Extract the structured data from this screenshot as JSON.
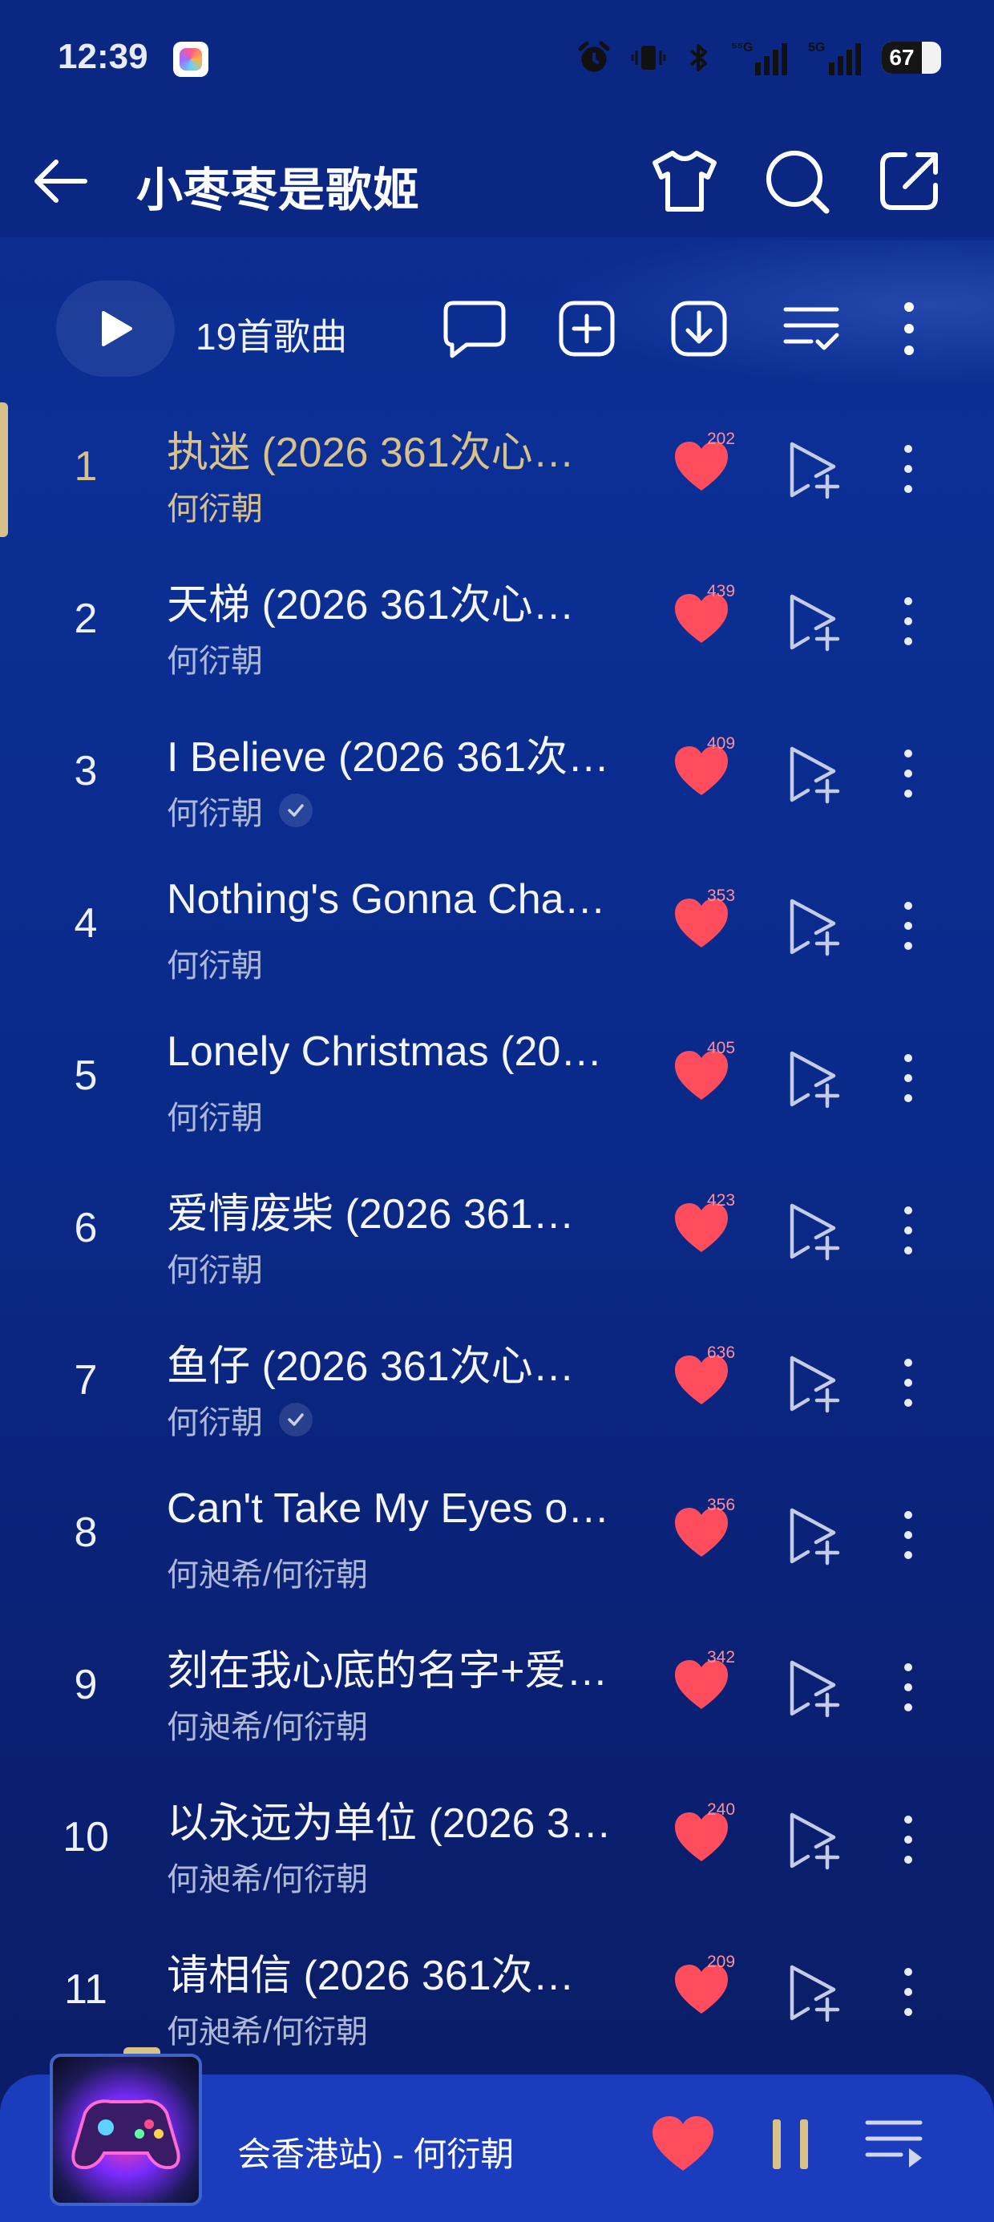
{
  "status_bar": {
    "time": "12:39",
    "network_1": "5G",
    "network_2": "5G",
    "battery": "67"
  },
  "header": {
    "title": "小枣枣是歌姬"
  },
  "toolbar": {
    "song_count": "19首歌曲"
  },
  "songs": [
    {
      "num": "1",
      "title": "执迷 (2026 361次心动…",
      "artist": "何衍朝",
      "likes": "202",
      "verified": false,
      "active": true
    },
    {
      "num": "2",
      "title": "天梯 (2026 361次心动…",
      "artist": "何衍朝",
      "likes": "439",
      "verified": false
    },
    {
      "num": "3",
      "title": "I Believe (2026 361次…",
      "artist": "何衍朝",
      "likes": "409",
      "verified": true
    },
    {
      "num": "4",
      "title": "Nothing's Gonna Chan…",
      "artist": "何衍朝",
      "likes": "353",
      "verified": false
    },
    {
      "num": "5",
      "title": "Lonely Christmas (20…",
      "artist": "何衍朝",
      "likes": "405",
      "verified": false
    },
    {
      "num": "6",
      "title": "爱情废柴 (2026 361次…",
      "artist": "何衍朝",
      "likes": "423",
      "verified": false
    },
    {
      "num": "7",
      "title": "鱼仔 (2026 361次心动…",
      "artist": "何衍朝",
      "likes": "636",
      "verified": true
    },
    {
      "num": "8",
      "title": "Can't Take My Eyes of…",
      "artist": "何昶希/何衍朝",
      "likes": "356",
      "verified": false
    },
    {
      "num": "9",
      "title": "刻在我心底的名字+爱…",
      "artist": "何昶希/何衍朝",
      "likes": "342",
      "verified": false
    },
    {
      "num": "10",
      "title": "以永远为单位 (2026 3…",
      "artist": "何昶希/何衍朝",
      "likes": "240",
      "verified": false
    },
    {
      "num": "11",
      "title": "请相信 (2026 361次心…",
      "artist": "何昶希/何衍朝",
      "likes": "209",
      "verified": false
    }
  ],
  "player": {
    "now_playing": "会香港站) - 何衍朝"
  },
  "colors": {
    "accent_gold": "#d9c289",
    "heart_red": "#ff4d5e",
    "bg_blue": "#0b2784",
    "player_blue": "#1a3cbd"
  }
}
